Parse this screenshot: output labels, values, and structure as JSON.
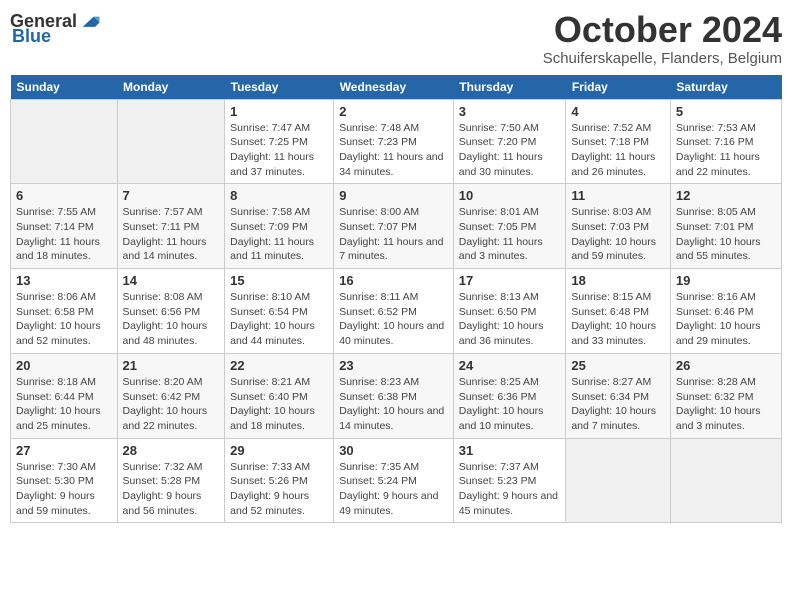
{
  "header": {
    "logo_general": "General",
    "logo_blue": "Blue",
    "title": "October 2024",
    "subtitle": "Schuiferskapelle, Flanders, Belgium"
  },
  "days_of_week": [
    "Sunday",
    "Monday",
    "Tuesday",
    "Wednesday",
    "Thursday",
    "Friday",
    "Saturday"
  ],
  "weeks": [
    [
      {
        "day": "",
        "empty": true
      },
      {
        "day": "",
        "empty": true
      },
      {
        "day": "1",
        "sunrise": "Sunrise: 7:47 AM",
        "sunset": "Sunset: 7:25 PM",
        "daylight": "Daylight: 11 hours and 37 minutes."
      },
      {
        "day": "2",
        "sunrise": "Sunrise: 7:48 AM",
        "sunset": "Sunset: 7:23 PM",
        "daylight": "Daylight: 11 hours and 34 minutes."
      },
      {
        "day": "3",
        "sunrise": "Sunrise: 7:50 AM",
        "sunset": "Sunset: 7:20 PM",
        "daylight": "Daylight: 11 hours and 30 minutes."
      },
      {
        "day": "4",
        "sunrise": "Sunrise: 7:52 AM",
        "sunset": "Sunset: 7:18 PM",
        "daylight": "Daylight: 11 hours and 26 minutes."
      },
      {
        "day": "5",
        "sunrise": "Sunrise: 7:53 AM",
        "sunset": "Sunset: 7:16 PM",
        "daylight": "Daylight: 11 hours and 22 minutes."
      }
    ],
    [
      {
        "day": "6",
        "sunrise": "Sunrise: 7:55 AM",
        "sunset": "Sunset: 7:14 PM",
        "daylight": "Daylight: 11 hours and 18 minutes."
      },
      {
        "day": "7",
        "sunrise": "Sunrise: 7:57 AM",
        "sunset": "Sunset: 7:11 PM",
        "daylight": "Daylight: 11 hours and 14 minutes."
      },
      {
        "day": "8",
        "sunrise": "Sunrise: 7:58 AM",
        "sunset": "Sunset: 7:09 PM",
        "daylight": "Daylight: 11 hours and 11 minutes."
      },
      {
        "day": "9",
        "sunrise": "Sunrise: 8:00 AM",
        "sunset": "Sunset: 7:07 PM",
        "daylight": "Daylight: 11 hours and 7 minutes."
      },
      {
        "day": "10",
        "sunrise": "Sunrise: 8:01 AM",
        "sunset": "Sunset: 7:05 PM",
        "daylight": "Daylight: 11 hours and 3 minutes."
      },
      {
        "day": "11",
        "sunrise": "Sunrise: 8:03 AM",
        "sunset": "Sunset: 7:03 PM",
        "daylight": "Daylight: 10 hours and 59 minutes."
      },
      {
        "day": "12",
        "sunrise": "Sunrise: 8:05 AM",
        "sunset": "Sunset: 7:01 PM",
        "daylight": "Daylight: 10 hours and 55 minutes."
      }
    ],
    [
      {
        "day": "13",
        "sunrise": "Sunrise: 8:06 AM",
        "sunset": "Sunset: 6:58 PM",
        "daylight": "Daylight: 10 hours and 52 minutes."
      },
      {
        "day": "14",
        "sunrise": "Sunrise: 8:08 AM",
        "sunset": "Sunset: 6:56 PM",
        "daylight": "Daylight: 10 hours and 48 minutes."
      },
      {
        "day": "15",
        "sunrise": "Sunrise: 8:10 AM",
        "sunset": "Sunset: 6:54 PM",
        "daylight": "Daylight: 10 hours and 44 minutes."
      },
      {
        "day": "16",
        "sunrise": "Sunrise: 8:11 AM",
        "sunset": "Sunset: 6:52 PM",
        "daylight": "Daylight: 10 hours and 40 minutes."
      },
      {
        "day": "17",
        "sunrise": "Sunrise: 8:13 AM",
        "sunset": "Sunset: 6:50 PM",
        "daylight": "Daylight: 10 hours and 36 minutes."
      },
      {
        "day": "18",
        "sunrise": "Sunrise: 8:15 AM",
        "sunset": "Sunset: 6:48 PM",
        "daylight": "Daylight: 10 hours and 33 minutes."
      },
      {
        "day": "19",
        "sunrise": "Sunrise: 8:16 AM",
        "sunset": "Sunset: 6:46 PM",
        "daylight": "Daylight: 10 hours and 29 minutes."
      }
    ],
    [
      {
        "day": "20",
        "sunrise": "Sunrise: 8:18 AM",
        "sunset": "Sunset: 6:44 PM",
        "daylight": "Daylight: 10 hours and 25 minutes."
      },
      {
        "day": "21",
        "sunrise": "Sunrise: 8:20 AM",
        "sunset": "Sunset: 6:42 PM",
        "daylight": "Daylight: 10 hours and 22 minutes."
      },
      {
        "day": "22",
        "sunrise": "Sunrise: 8:21 AM",
        "sunset": "Sunset: 6:40 PM",
        "daylight": "Daylight: 10 hours and 18 minutes."
      },
      {
        "day": "23",
        "sunrise": "Sunrise: 8:23 AM",
        "sunset": "Sunset: 6:38 PM",
        "daylight": "Daylight: 10 hours and 14 minutes."
      },
      {
        "day": "24",
        "sunrise": "Sunrise: 8:25 AM",
        "sunset": "Sunset: 6:36 PM",
        "daylight": "Daylight: 10 hours and 10 minutes."
      },
      {
        "day": "25",
        "sunrise": "Sunrise: 8:27 AM",
        "sunset": "Sunset: 6:34 PM",
        "daylight": "Daylight: 10 hours and 7 minutes."
      },
      {
        "day": "26",
        "sunrise": "Sunrise: 8:28 AM",
        "sunset": "Sunset: 6:32 PM",
        "daylight": "Daylight: 10 hours and 3 minutes."
      }
    ],
    [
      {
        "day": "27",
        "sunrise": "Sunrise: 7:30 AM",
        "sunset": "Sunset: 5:30 PM",
        "daylight": "Daylight: 9 hours and 59 minutes."
      },
      {
        "day": "28",
        "sunrise": "Sunrise: 7:32 AM",
        "sunset": "Sunset: 5:28 PM",
        "daylight": "Daylight: 9 hours and 56 minutes."
      },
      {
        "day": "29",
        "sunrise": "Sunrise: 7:33 AM",
        "sunset": "Sunset: 5:26 PM",
        "daylight": "Daylight: 9 hours and 52 minutes."
      },
      {
        "day": "30",
        "sunrise": "Sunrise: 7:35 AM",
        "sunset": "Sunset: 5:24 PM",
        "daylight": "Daylight: 9 hours and 49 minutes."
      },
      {
        "day": "31",
        "sunrise": "Sunrise: 7:37 AM",
        "sunset": "Sunset: 5:23 PM",
        "daylight": "Daylight: 9 hours and 45 minutes."
      },
      {
        "day": "",
        "empty": true
      },
      {
        "day": "",
        "empty": true
      }
    ]
  ]
}
